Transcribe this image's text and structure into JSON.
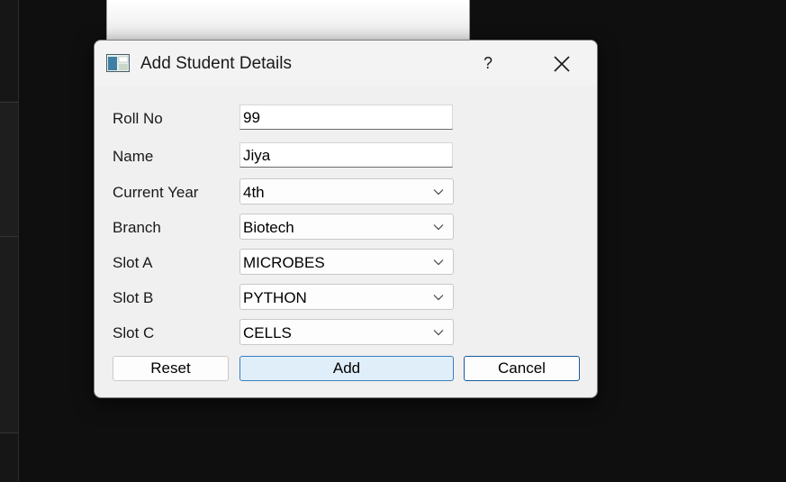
{
  "dialog": {
    "title": "Add Student Details",
    "help_label": "?",
    "icons": {
      "app": "form-window-icon",
      "close": "close-icon",
      "dropdown": "chevron-down-icon"
    }
  },
  "form": {
    "roll_no": {
      "label": "Roll No",
      "value": "99"
    },
    "name": {
      "label": "Name",
      "value": "Jiya"
    },
    "current_year": {
      "label": "Current Year",
      "value": "4th"
    },
    "branch": {
      "label": "Branch",
      "value": "Biotech"
    },
    "slot_a": {
      "label": "Slot A",
      "value": "MICROBES"
    },
    "slot_b": {
      "label": "Slot B",
      "value": "PYTHON"
    },
    "slot_c": {
      "label": "Slot C",
      "value": "CELLS"
    }
  },
  "buttons": {
    "reset": "Reset",
    "add": "Add",
    "cancel": "Cancel"
  },
  "colors": {
    "dialog_bg": "#f0f0f0",
    "desktop_bg": "#0f0f0f",
    "default_button_border": "#3a7ec2",
    "default_button_fill": "#e0eef9"
  }
}
